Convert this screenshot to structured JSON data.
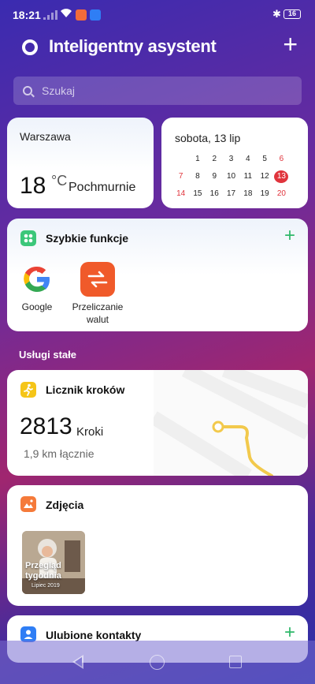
{
  "status": {
    "time": "18:21",
    "battery": "16"
  },
  "header": {
    "title": "Inteligentny asystent"
  },
  "search": {
    "placeholder": "Szukaj"
  },
  "weather": {
    "city": "Warszawa",
    "temperature": "18",
    "unit": "°C",
    "condition": "Pochmurnie"
  },
  "calendar": {
    "date_label": "sobota, 13 lip",
    "days": [
      [
        "",
        "1",
        "2",
        "3",
        "4",
        "5",
        "6"
      ],
      [
        "7",
        "8",
        "9",
        "10",
        "11",
        "12",
        "13"
      ],
      [
        "14",
        "15",
        "16",
        "17",
        "18",
        "19",
        "20"
      ]
    ],
    "today": "13"
  },
  "quick_functions": {
    "title": "Szybkie funkcje",
    "apps": [
      {
        "label": "Google",
        "icon": "google-icon"
      },
      {
        "label": "Przeliczanie walut",
        "label_line1": "Przeliczanie",
        "label_line2": "walut",
        "icon": "currency-exchange-icon"
      }
    ]
  },
  "section_label": "Usługi stałe",
  "steps": {
    "title": "Licznik kroków",
    "count": "2813",
    "unit": "Kroki",
    "distance": "1,9 km łącznie"
  },
  "photos": {
    "title": "Zdjęcia",
    "thumb_title_line1": "Przegląd",
    "thumb_title_line2": "tygodnia",
    "thumb_sub": "Lipiec 2019"
  },
  "contacts": {
    "title": "Ulubione kontakty"
  },
  "colors": {
    "accent_green": "#2fb86a",
    "today_red": "#e0343c",
    "currency_orange": "#f05a2a",
    "steps_yellow": "#f5c518",
    "photos_orange": "#f57a3a",
    "contacts_blue": "#2f7ef5",
    "quick_green": "#3cc77a"
  }
}
